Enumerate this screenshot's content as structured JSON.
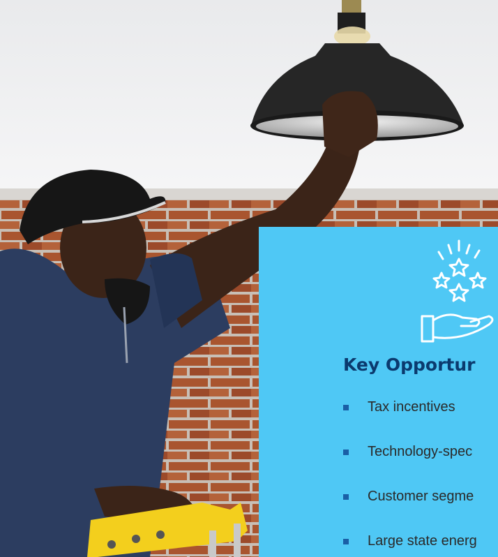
{
  "panel": {
    "title": "Key Opportur",
    "icon": "hand-with-stars-icon",
    "bullets": [
      "Tax incentives",
      "Technology-spec",
      "Customer segme",
      "Large state energ"
    ]
  },
  "colors": {
    "panel_background": "#4fc8f5",
    "title": "#0b3a6e",
    "bullet_marker": "#1a5fa6"
  }
}
